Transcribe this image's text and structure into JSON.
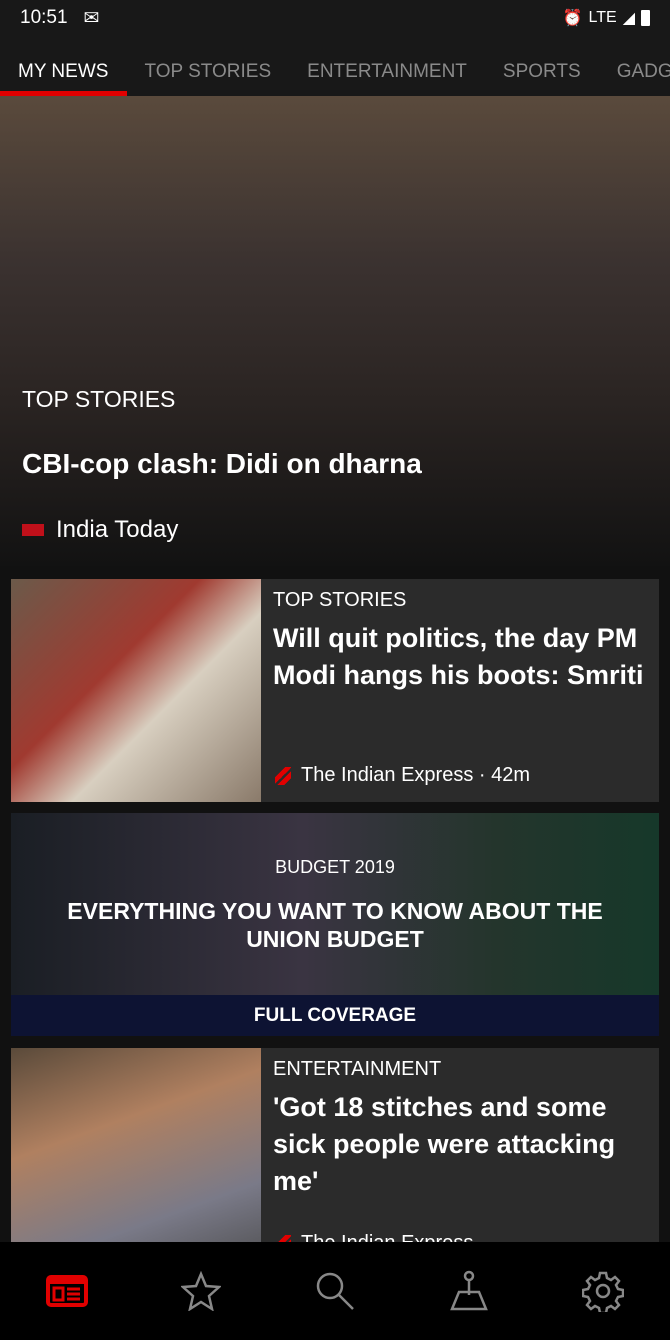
{
  "status": {
    "time": "10:51",
    "network": "LTE"
  },
  "tabs": [
    "MY NEWS",
    "TOP STORIES",
    "ENTERTAINMENT",
    "SPORTS",
    "GADG"
  ],
  "hero": {
    "category": "TOP STORIES",
    "title": "CBI-cop clash: Didi on dharna",
    "source": "India Today"
  },
  "cards": [
    {
      "category": "TOP STORIES",
      "title": "Will quit politics, the day PM Modi hangs his boots: Smriti",
      "source": "The Indian Express · 42m"
    },
    {
      "category": "ENTERTAINMENT",
      "title": "'Got 18 stitches and some sick people were attacking me'",
      "source": "The Indian Express"
    }
  ],
  "budget": {
    "category": "BUDGET 2019",
    "title": "EVERYTHING YOU WANT TO KNOW ABOUT THE UNION BUDGET",
    "action": "FULL COVERAGE"
  },
  "nav": [
    "newspaper-icon",
    "star-icon",
    "search-icon",
    "joystick-icon",
    "gear-icon"
  ],
  "colors": {
    "accent": "#e10000",
    "background": "#181818",
    "card": "#2b2b2b"
  }
}
